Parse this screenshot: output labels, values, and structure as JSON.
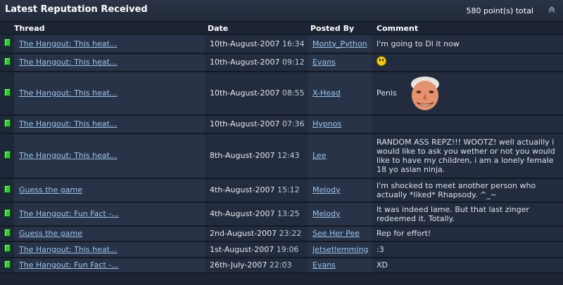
{
  "header": {
    "title": "Latest Reputation Received",
    "total": "580 point(s) total"
  },
  "columns": {
    "thread": "Thread",
    "date": "Date",
    "posted_by": "Posted By",
    "comment": "Comment"
  },
  "rows": [
    {
      "thread": "The Hangout: This heat...",
      "date": "10th-August-2007",
      "time": "16:34",
      "posted_by": "Monty_Python",
      "comment": "I'm going to Dl it now"
    },
    {
      "thread": "The Hangout: This heat...",
      "date": "10th-August-2007",
      "time": "09:12",
      "posted_by": "Evans",
      "comment": "",
      "comment_icon": "smiley-icon"
    },
    {
      "thread": "The Hangout: This heat...",
      "date": "10th-August-2007",
      "time": "08:55",
      "posted_by": "X-Head",
      "comment": "Penis",
      "comment_icon": "face-image"
    },
    {
      "thread": "The Hangout: This heat...",
      "date": "10th-August-2007",
      "time": "07:36",
      "posted_by": "Hypnos",
      "comment": ""
    },
    {
      "thread": "The Hangout: This heat...",
      "date": "8th-August-2007",
      "time": "12:43",
      "posted_by": "Lee",
      "comment": "RANDOM ASS REPZ!!! WOOTZ! well actuallly i would like to ask you wether or not you would like to have my children, i am a lonely female 18 yo asian ninja."
    },
    {
      "thread": "Guess the game",
      "date": "4th-August-2007",
      "time": "15:12",
      "posted_by": "Melody",
      "comment": "I'm shocked to meet another person who actually *liked* Rhapsody. ^_~"
    },
    {
      "thread": "The Hangout: Fun Fact -...",
      "date": "4th-August-2007",
      "time": "13:25",
      "posted_by": "Melody",
      "comment": "It was indeed lame. But that last zinger redeemed it. Totally."
    },
    {
      "thread": "Guess the game",
      "date": "2nd-August-2007",
      "time": "23:22",
      "posted_by": "See Her Pee",
      "comment": "Rep for effort!"
    },
    {
      "thread": "The Hangout: This heat...",
      "date": "1st-August-2007",
      "time": "19:06",
      "posted_by": "Jetsetlemming",
      "comment": ":3"
    },
    {
      "thread": "The Hangout: Fun Fact -...",
      "date": "26th-July-2007",
      "time": "22:03",
      "posted_by": "Evans",
      "comment": "XD"
    }
  ],
  "icons": {
    "row_marker": "green-rep-icon",
    "collapse": "collapse-arrow-icon"
  },
  "colors": {
    "background": "#1c2433",
    "link": "#9cc4ea",
    "rep_positive": "#2ecc2e"
  }
}
